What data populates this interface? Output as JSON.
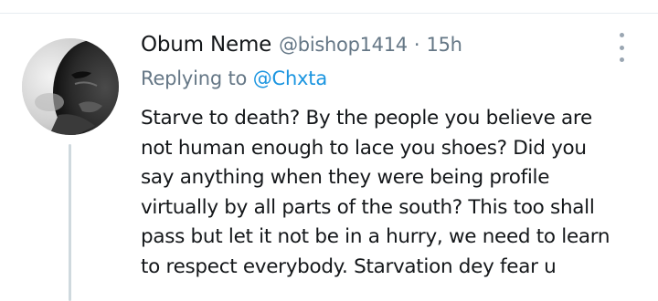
{
  "tweet": {
    "display_name": "Obum Neme",
    "handle": "@bishop1414",
    "separator": "·",
    "timestamp": "15h",
    "reply_prefix": "Replying to",
    "reply_to": "@Chxta",
    "body_lines": [
      "Starve to death? By the people you believe are",
      "not human enough to lace you shoes? Did you",
      "say anything when they were being profile",
      "virtually by all parts of the south? This too shall",
      "pass but let it not be in a hurry, we need to learn",
      "to respect everybody. Starvation dey fear u"
    ]
  },
  "icons": {
    "more": "more-options-vertical-icon",
    "avatar": "profile-photo"
  },
  "colors": {
    "secondary_text": "#657786",
    "link": "#1b95e0",
    "thread_line": "#cfd9de",
    "primary_text": "#14171a"
  }
}
